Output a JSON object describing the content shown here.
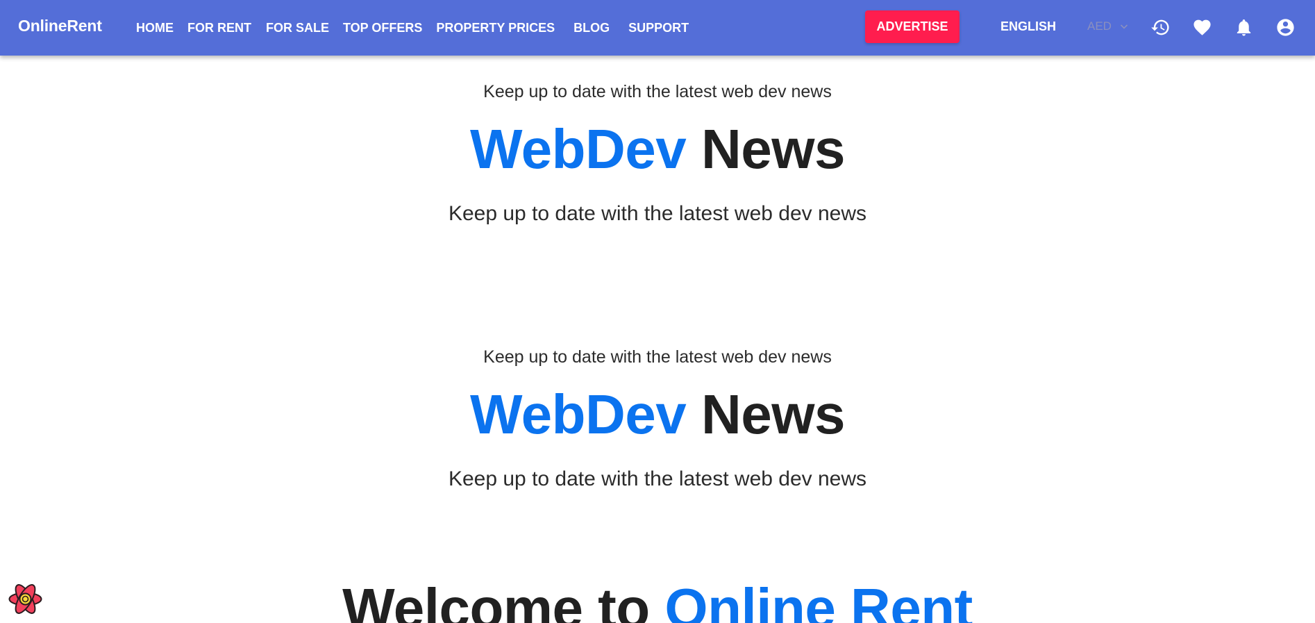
{
  "brand": "OnlineRent",
  "nav": [
    "HOME",
    "FOR RENT",
    "FOR SALE",
    "TOP OFFERS",
    "PROPERTY PRICES",
    "BLOG",
    "SUPPORT"
  ],
  "advertise_label": "ADVERTISE",
  "language_label": "ENGLISH",
  "currency_label": "AED",
  "hero_sections": [
    {
      "kicker": "Keep up to date with the latest web dev news",
      "headline_accent": "WebDev",
      "headline_rest": "News",
      "sub": "Keep up to date with the latest web dev news"
    },
    {
      "kicker": "Keep up to date with the latest web dev news",
      "headline_accent": "WebDev",
      "headline_rest": "News",
      "sub": "Keep up to date with the latest web dev news"
    }
  ],
  "welcome": {
    "prefix": "Welcome to",
    "accent": "Online Rent"
  },
  "colors": {
    "appbar": "#546ed8",
    "advertise": "#ff1d4e",
    "accent_text": "#0b73ef"
  },
  "icons": [
    "history-icon",
    "heart-icon",
    "bell-icon",
    "account-circle-icon",
    "react-logo-icon"
  ]
}
